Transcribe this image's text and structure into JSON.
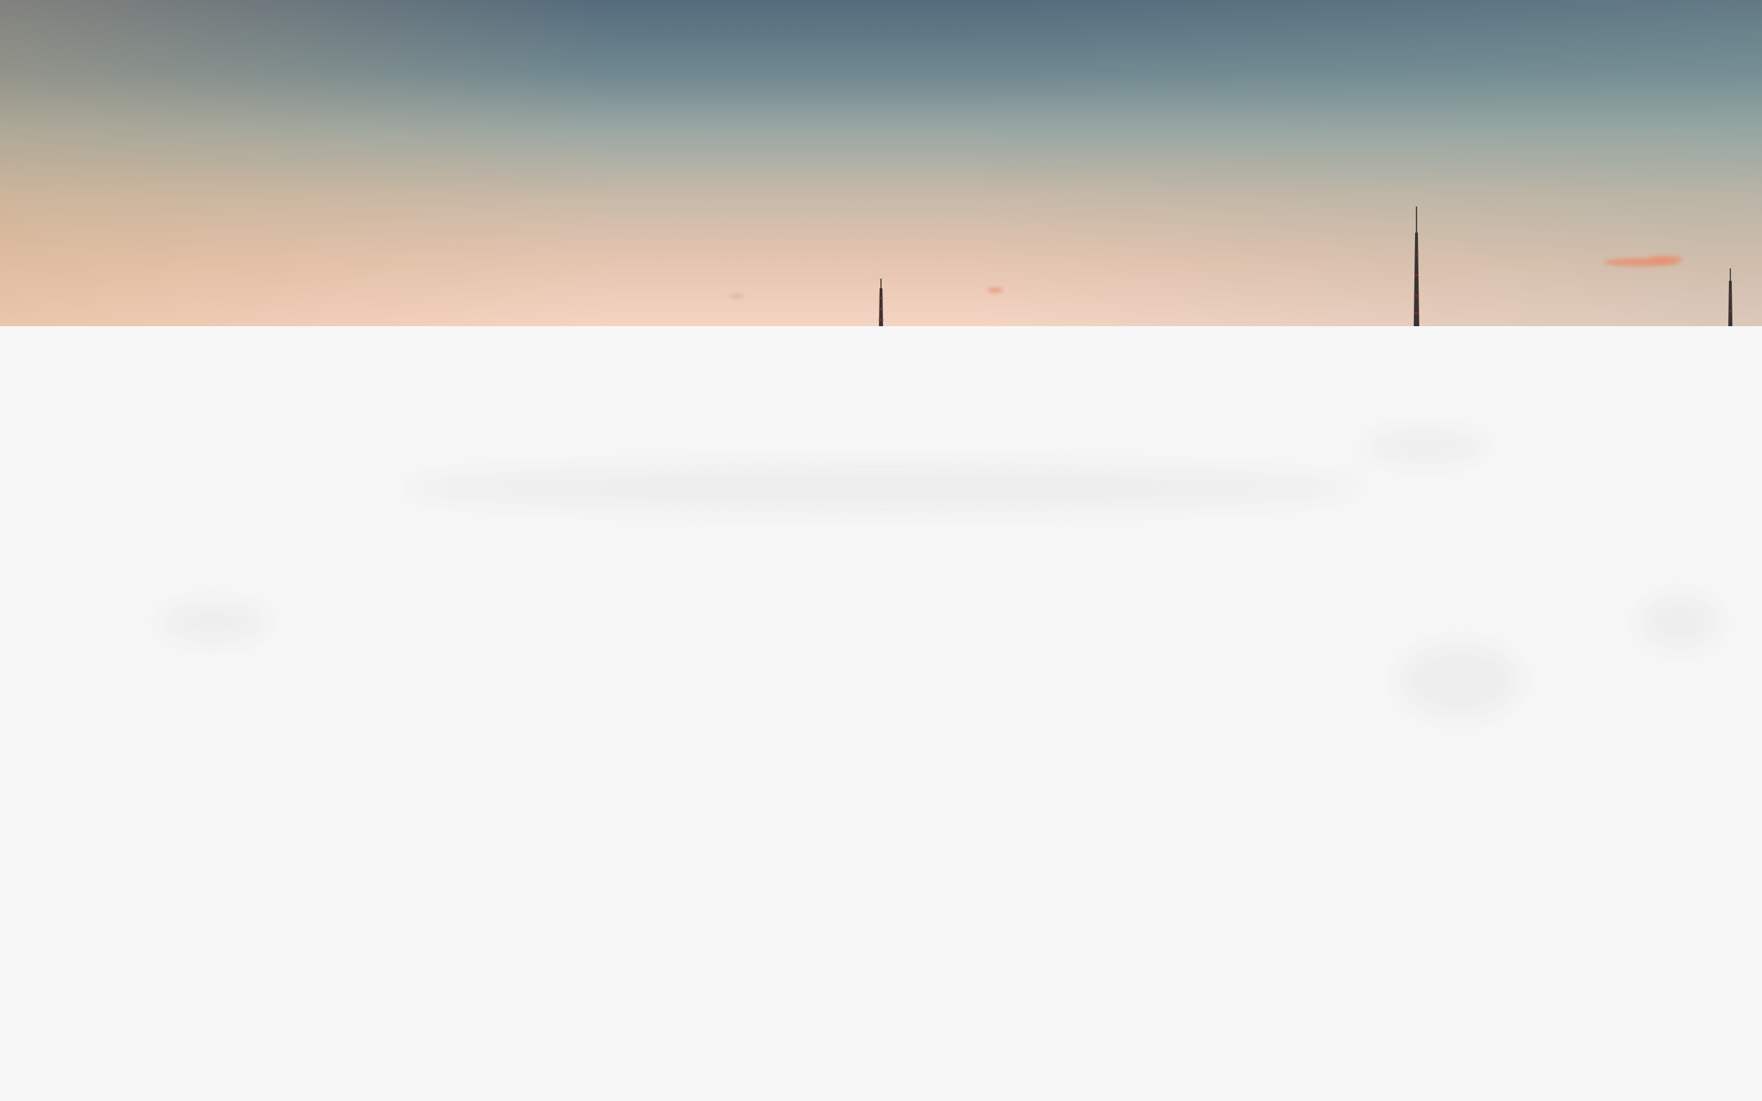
{
  "screen": {
    "type": "desktop-wallpaper",
    "scene": "winter-dusk-horizon"
  },
  "colors": {
    "sky_top": "#546b7c",
    "sky_horizon": "#f5d4c3",
    "snow": "#f7f7f7",
    "cloud": "#e88c6e",
    "tower": "#2f2a2a"
  },
  "icons": [
    "radio-tower-icon",
    "radio-tower-icon",
    "radio-tower-icon",
    "cloud-icon"
  ]
}
